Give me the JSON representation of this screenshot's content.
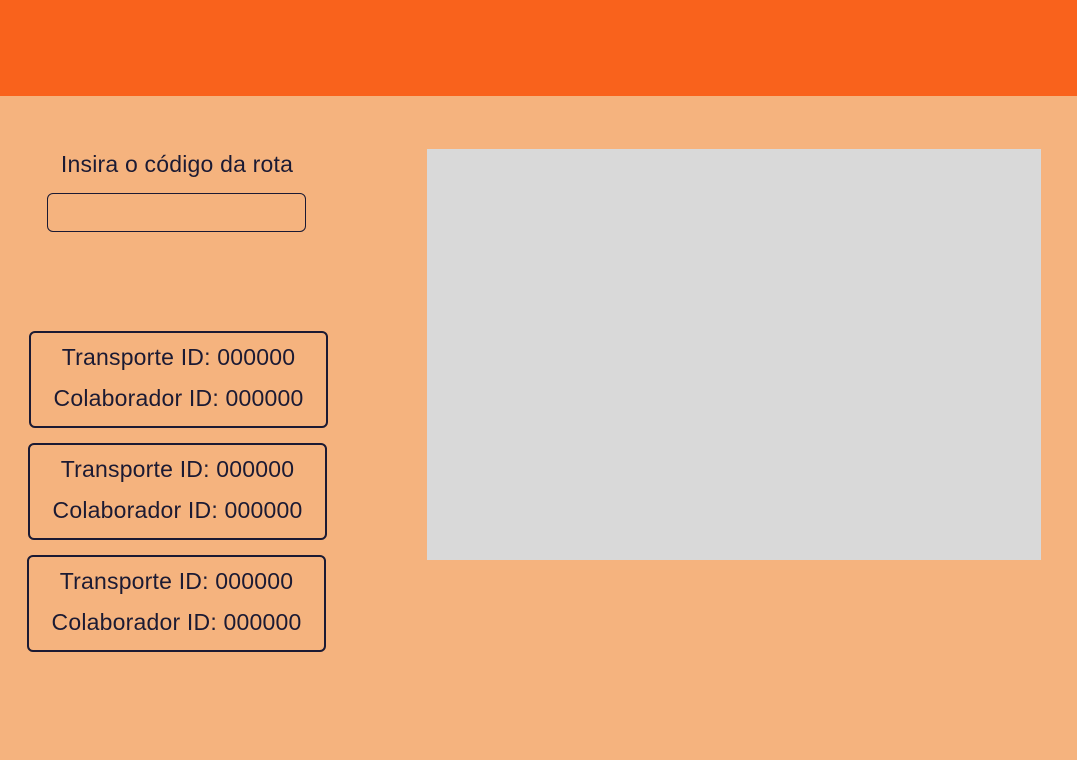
{
  "colors": {
    "header": "#f9621c",
    "background": "#f5b37e",
    "map_panel": "#d9d9d9",
    "border_text": "#1b1a33"
  },
  "route_search": {
    "label": "Insira o código da rota",
    "value": "",
    "placeholder": ""
  },
  "route_cards": [
    {
      "transport_label": "Transporte ID: 000000",
      "collaborator_label": "Colaborador ID: 000000"
    },
    {
      "transport_label": "Transporte ID: 000000",
      "collaborator_label": "Colaborador ID: 000000"
    },
    {
      "transport_label": "Transporte ID: 000000",
      "collaborator_label": "Colaborador ID: 000000"
    }
  ]
}
